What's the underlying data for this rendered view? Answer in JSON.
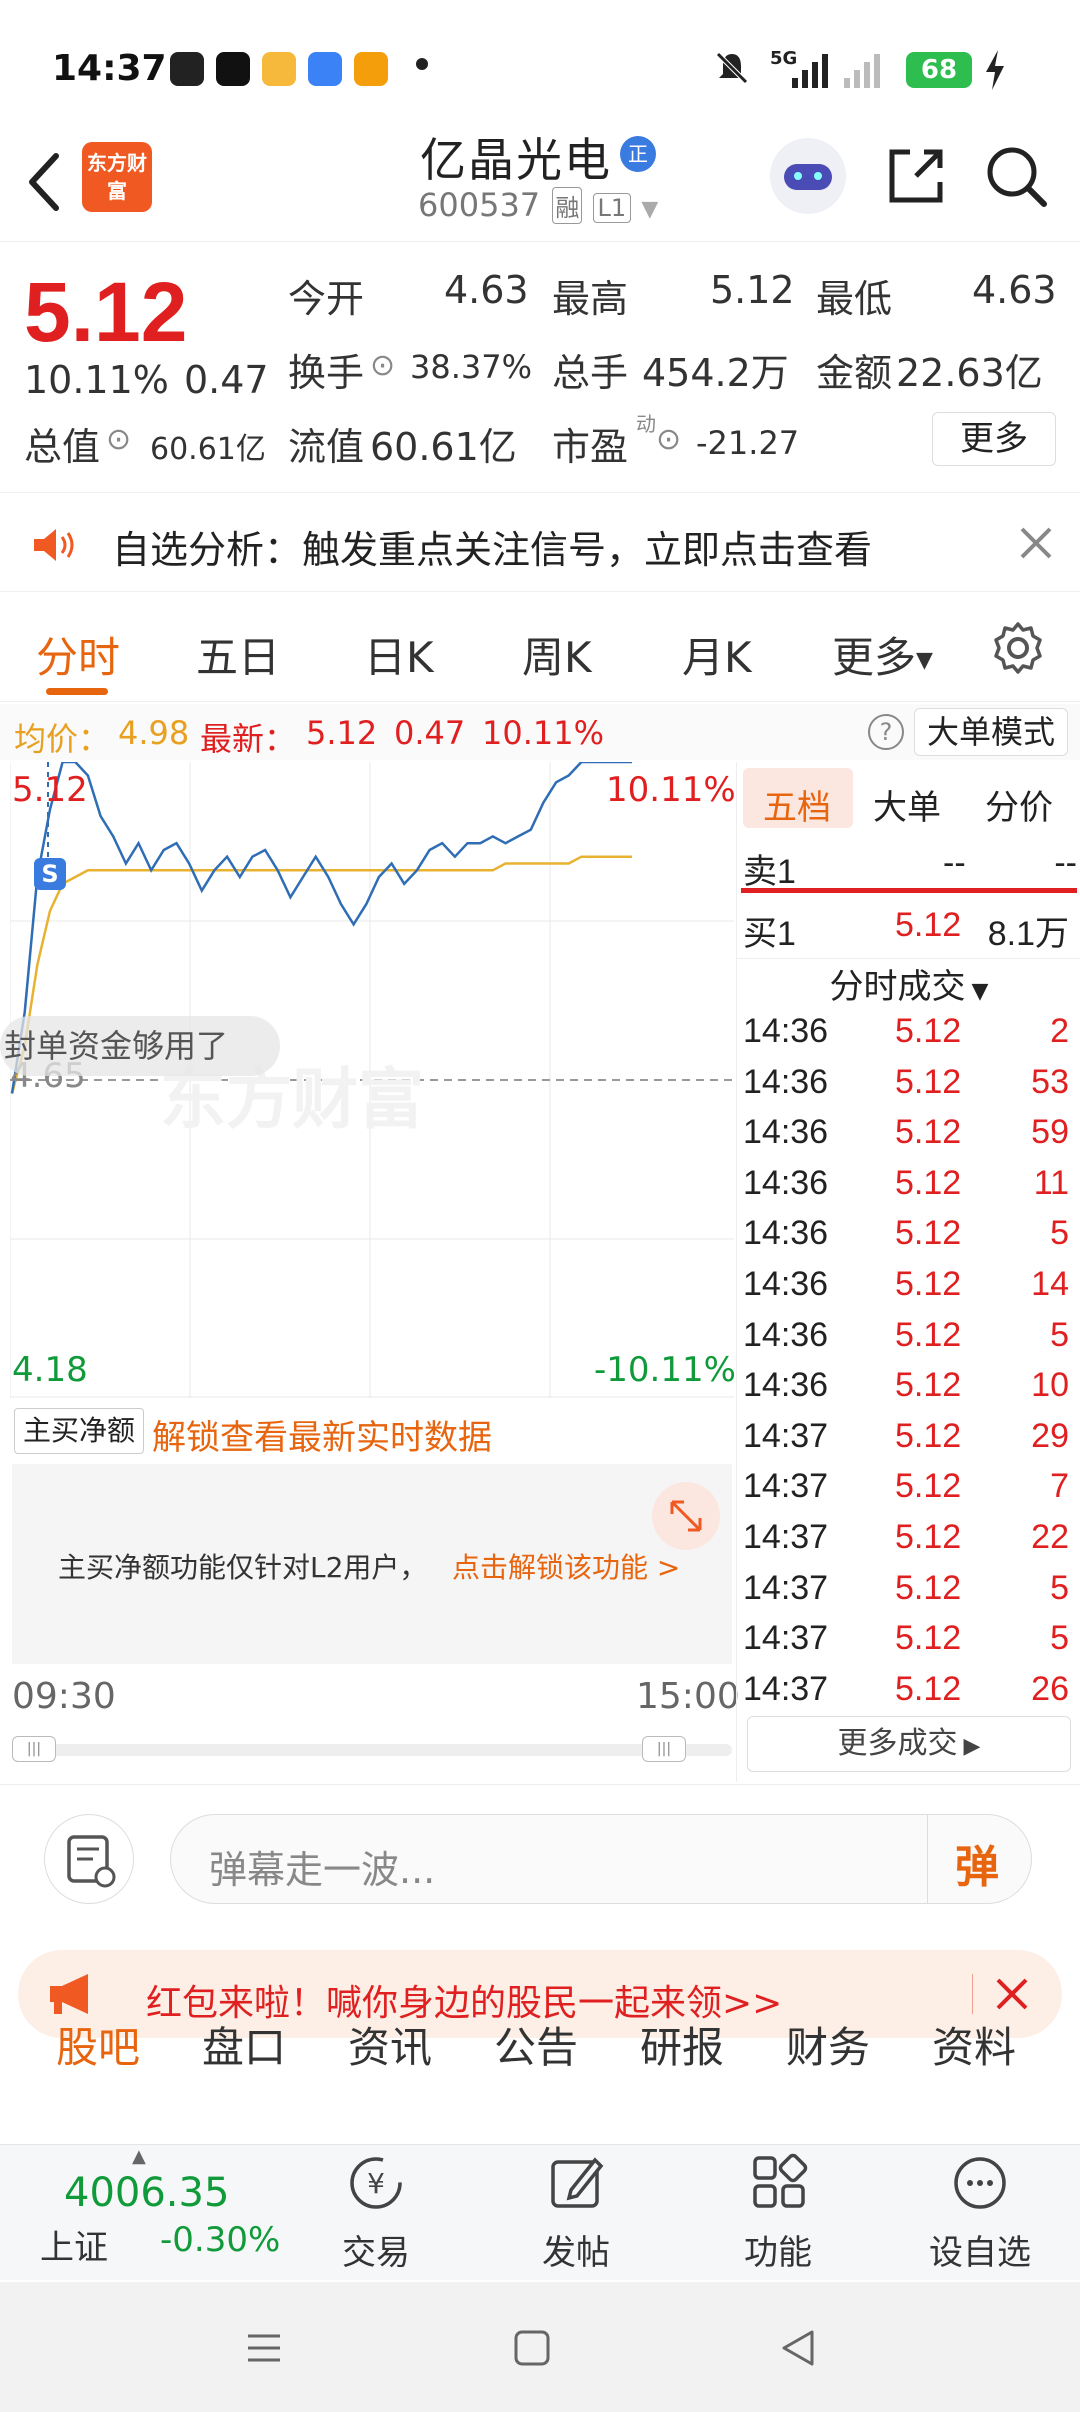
{
  "status_bar": {
    "time": "14:37",
    "battery": "68",
    "network": "5G"
  },
  "header": {
    "logo_text": "东方财富",
    "stock_name": "亿晶光电",
    "stock_code": "600537",
    "tag_margin": "融",
    "tag_level": "L1",
    "badge": "正"
  },
  "quote": {
    "price": "5.12",
    "change_pct": "10.11%",
    "change": "0.47",
    "open_label": "今开",
    "open_value": "4.63",
    "high_label": "最高",
    "high_value": "5.12",
    "low_label": "最低",
    "low_value": "4.63",
    "turnover_label": "换手",
    "turnover_value": "38.37%",
    "volume_label": "总手",
    "volume_value": "454.2万",
    "amount_label": "金额",
    "amount_value": "22.63亿",
    "total_cap_label": "总值",
    "total_cap_value": "60.61亿",
    "float_cap_label": "流值",
    "float_cap_value": "60.61亿",
    "pe_label": "市盈",
    "pe_sup": "动",
    "pe_value": "-21.27",
    "more_label": "更多"
  },
  "notice": {
    "text": "自选分析：触发重点关注信号，立即点击查看"
  },
  "tabs": [
    "分时",
    "五日",
    "日K",
    "周K",
    "月K",
    "更多"
  ],
  "info_row": {
    "avg_label": "均价：",
    "avg_value": "4.98",
    "latest_label": "最新：",
    "latest_value": "5.12",
    "latest_change": "0.47",
    "latest_pct": "10.11%",
    "mode_button": "大单模式"
  },
  "chart": {
    "top_price": "5.12",
    "top_pct": "10.11%",
    "mid_price": "4.65",
    "bottom_price": "4.18",
    "bottom_pct": "-10.11%",
    "overlay_text": "封单资金够用了",
    "watermark": "东方财富",
    "time_start": "09:30",
    "time_end": "15:00",
    "marker": "S"
  },
  "chart_data": {
    "type": "line",
    "ylim": [
      4.18,
      5.12
    ],
    "series": [
      {
        "name": "最新",
        "values": [
          4.63,
          4.75,
          4.95,
          5.05,
          5.12,
          5.12,
          5.1,
          5.04,
          5.01,
          4.97,
          5.0,
          4.96,
          4.99,
          5.0,
          4.97,
          4.93,
          4.96,
          4.98,
          4.95,
          4.98,
          4.99,
          4.96,
          4.92,
          4.95,
          4.98,
          4.95,
          4.91,
          4.88,
          4.91,
          4.95,
          4.97,
          4.94,
          4.96,
          4.99,
          5.0,
          4.98,
          5.0,
          5.0,
          5.01,
          5.0,
          5.01,
          5.02,
          5.06,
          5.09,
          5.1,
          5.12,
          5.12,
          5.12,
          5.12,
          5.12
        ]
      },
      {
        "name": "均价",
        "values": [
          4.63,
          4.7,
          4.82,
          4.9,
          4.94,
          4.95,
          4.96,
          4.96,
          4.96,
          4.96,
          4.96,
          4.96,
          4.96,
          4.96,
          4.96,
          4.96,
          4.96,
          4.96,
          4.96,
          4.96,
          4.96,
          4.96,
          4.96,
          4.96,
          4.96,
          4.96,
          4.96,
          4.96,
          4.96,
          4.96,
          4.96,
          4.96,
          4.96,
          4.96,
          4.96,
          4.96,
          4.96,
          4.96,
          4.96,
          4.97,
          4.97,
          4.97,
          4.97,
          4.97,
          4.97,
          4.98,
          4.98,
          4.98,
          4.98,
          4.98
        ]
      }
    ]
  },
  "main_buy": {
    "selector": "主买净额",
    "unlock_text": "解锁查看最新实时数据",
    "desc": "主买净额功能仅针对L2用户，",
    "link": "点击解锁该功能 >"
  },
  "right_panel": {
    "tabs": [
      "五档",
      "大单",
      "分价"
    ],
    "sell1_label": "卖1",
    "sell1_price": "--",
    "sell1_vol": "--",
    "buy1_label": "买1",
    "buy1_price": "5.12",
    "buy1_vol": "8.1万",
    "trades_header": "分时成交",
    "trades": [
      {
        "time": "14:36",
        "price": "5.12",
        "vol": "2"
      },
      {
        "time": "14:36",
        "price": "5.12",
        "vol": "53"
      },
      {
        "time": "14:36",
        "price": "5.12",
        "vol": "59"
      },
      {
        "time": "14:36",
        "price": "5.12",
        "vol": "11"
      },
      {
        "time": "14:36",
        "price": "5.12",
        "vol": "5"
      },
      {
        "time": "14:36",
        "price": "5.12",
        "vol": "14"
      },
      {
        "time": "14:36",
        "price": "5.12",
        "vol": "5"
      },
      {
        "time": "14:36",
        "price": "5.12",
        "vol": "10"
      },
      {
        "time": "14:37",
        "price": "5.12",
        "vol": "29"
      },
      {
        "time": "14:37",
        "price": "5.12",
        "vol": "7"
      },
      {
        "time": "14:37",
        "price": "5.12",
        "vol": "22"
      },
      {
        "time": "14:37",
        "price": "5.12",
        "vol": "5"
      },
      {
        "time": "14:37",
        "price": "5.12",
        "vol": "5"
      },
      {
        "time": "14:37",
        "price": "5.12",
        "vol": "26"
      }
    ],
    "more_trades": "更多成交"
  },
  "comment": {
    "placeholder": "弹幕走一波...",
    "danmu_label": "弹"
  },
  "promo": {
    "text": "红包来啦！喊你身边的股民一起来领>>"
  },
  "bottom_tabs": [
    "股吧",
    "盘口",
    "资讯",
    "公告",
    "研报",
    "财务",
    "资料"
  ],
  "bottom_nav": {
    "index_value": "4006.35",
    "index_name": "上证",
    "index_pct": "-0.30%",
    "items": [
      "交易",
      "发帖",
      "功能",
      "设自选"
    ]
  },
  "colors": {
    "up": "#e02020",
    "down": "#119a3a",
    "accent": "#e8650f",
    "price_line": "#2f6db5",
    "avg_line": "#e8b230"
  }
}
